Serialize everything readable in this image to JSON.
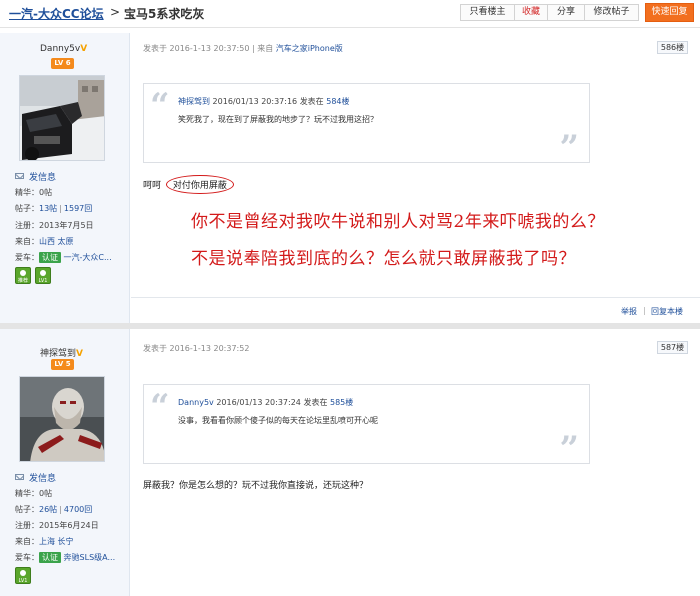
{
  "header": {
    "forum_link": "一汽-大众CC论坛",
    "separator": ">",
    "thread_title": "宝马5系求吃灰",
    "buttons": [
      "只看楼主",
      "收藏",
      "分享",
      "修改帖子"
    ],
    "quick_reply": "快速回复"
  },
  "posts": [
    {
      "user": {
        "name": "Danny5v",
        "verified_mark": "V",
        "level": "LV 6",
        "send_message": "发信息",
        "stats": {
          "essence_label": "精华：",
          "essence_value": "0帖",
          "posts_label": "帖子：",
          "posts_value": "13帖",
          "replies_value": "1597回",
          "reg_label": "注册：",
          "reg_value": "2013年7月5日",
          "from_label": "来自：",
          "from_value": "山西 太原",
          "car_label": "爱车：",
          "cert_label": "认证",
          "car_value": "一汽-大众C..."
        },
        "medals": [
          "推荐",
          "LV1"
        ]
      },
      "meta": {
        "prefix": "发表于 2016-1-13 20:37:50",
        "divider": "|",
        "source_prefix": "来自",
        "source": "汽车之家iPhone版"
      },
      "floor": "586楼",
      "quote": {
        "author": "神探驾到",
        "date": "2016/01/13 20:37:16",
        "posted_in": "发表在",
        "floor": "584楼",
        "text": "笑死我了，现在到了屏蔽我的地步了？玩不过我用这招？"
      },
      "reply_prefix": "呵呵",
      "reply_circled": "对付你用屏蔽",
      "annotation_lines": [
        "你不是曾经对我吹牛说和别人对骂2年来吓唬我的么？",
        "不是说奉陪我到底的么？怎么就只敢屏蔽我了吗？"
      ],
      "footer": {
        "report": "举报",
        "divider": "|",
        "reply": "回复本楼"
      }
    },
    {
      "user": {
        "name": "神探驾到",
        "verified_mark": "V",
        "level": "LV 5",
        "send_message": "发信息",
        "stats": {
          "essence_label": "精华：",
          "essence_value": "0帖",
          "posts_label": "帖子：",
          "posts_value": "26帖",
          "replies_value": "4700回",
          "reg_label": "注册：",
          "reg_value": "2015年6月24日",
          "from_label": "来自：",
          "from_value": "上海 长宁",
          "car_label": "爱车：",
          "cert_label": "认证",
          "car_value": "奔驰SLS级A..."
        },
        "medals": [
          "LV1"
        ]
      },
      "meta": {
        "prefix": "发表于 2016-1-13 20:37:52"
      },
      "floor": "587楼",
      "quote": {
        "author": "Danny5v",
        "date": "2016/01/13 20:37:24",
        "posted_in": "发表在",
        "floor": "585楼",
        "text": "没事，我看看你顾个傻子似的每天在论坛里乱喷可开心呢"
      },
      "reply": "屏蔽我？你是怎么想的？玩不过我你直接说，还玩这种？"
    }
  ]
}
